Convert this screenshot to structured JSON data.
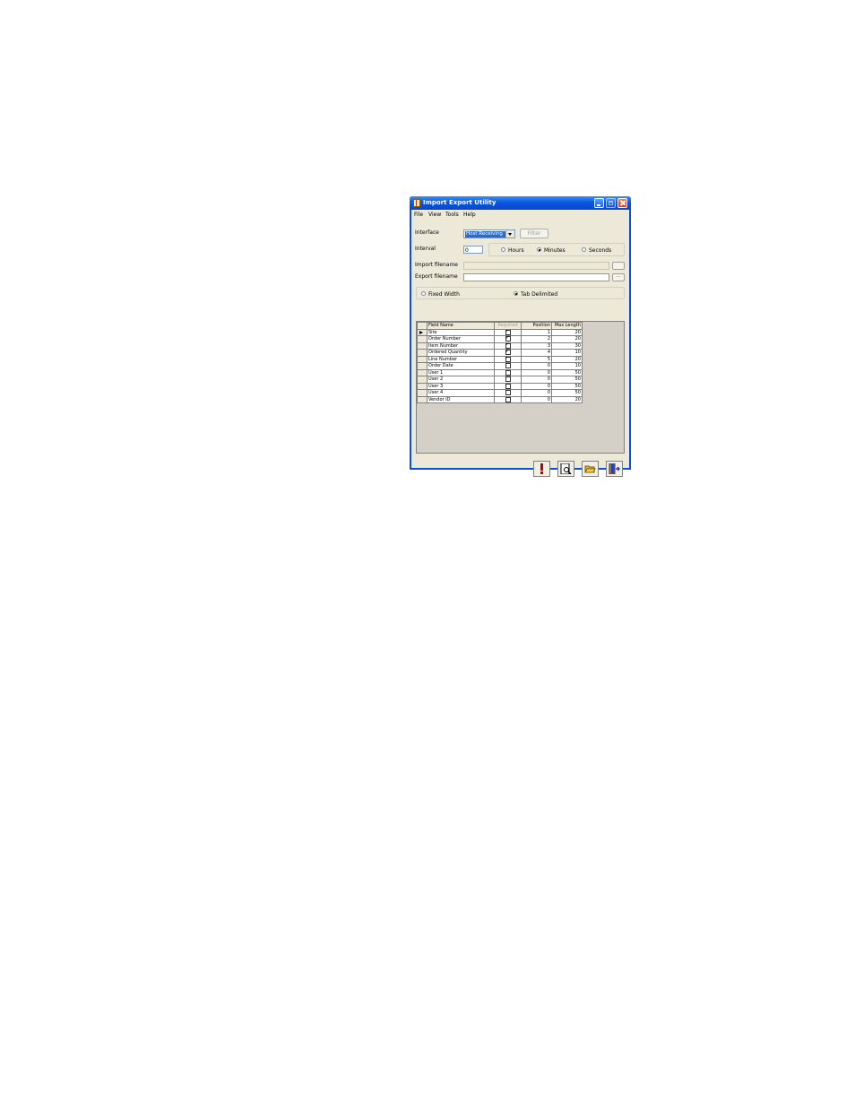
{
  "window": {
    "title": "Import Export Utility"
  },
  "menu": [
    "File",
    "View",
    "Tools",
    "Help"
  ],
  "form": {
    "interface_label": "Interface",
    "interface_value": "Host Receiving",
    "filter_label": "Filter",
    "interval_label": "Interval",
    "interval_value": "0",
    "hours_label": "Hours",
    "minutes_label": "Minutes",
    "seconds_label": "Seconds",
    "interval_unit_selected": "Minutes",
    "import_filename_label": "Import filename",
    "export_filename_label": "Export filename",
    "browse_label": "...",
    "fixed_width_label": "Fixed Width",
    "tab_delimited_label": "Tab Delimited",
    "format_selected": "Tab Delimited"
  },
  "grid": {
    "columns": [
      "Field Name",
      "Required",
      "Position",
      "Max Length"
    ],
    "rows": [
      {
        "field": "Site",
        "required": true,
        "position": "1",
        "max_length": "20"
      },
      {
        "field": "Order Number",
        "required": true,
        "position": "2",
        "max_length": "20"
      },
      {
        "field": "Item Number",
        "required": true,
        "position": "3",
        "max_length": "30"
      },
      {
        "field": "Ordered Quantity",
        "required": true,
        "position": "4",
        "max_length": "10"
      },
      {
        "field": "Line Number",
        "required": true,
        "position": "5",
        "max_length": "20"
      },
      {
        "field": "Order Date",
        "required": false,
        "position": "0",
        "max_length": "10"
      },
      {
        "field": "User 1",
        "required": false,
        "position": "0",
        "max_length": "50"
      },
      {
        "field": "User 2",
        "required": false,
        "position": "0",
        "max_length": "50"
      },
      {
        "field": "User 3",
        "required": false,
        "position": "0",
        "max_length": "50"
      },
      {
        "field": "User 4",
        "required": false,
        "position": "0",
        "max_length": "50"
      },
      {
        "field": "Vendor ID",
        "required": false,
        "position": "0",
        "max_length": "20"
      }
    ]
  },
  "toolbar": {
    "icons": [
      "run-icon",
      "preview-icon",
      "open-folder-icon",
      "exit-icon"
    ],
    "colors": {
      "run": "#c00000",
      "folder": "#e0b020",
      "exit": "#2040c0"
    }
  }
}
